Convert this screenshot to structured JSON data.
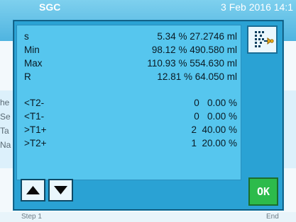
{
  "background": {
    "title_left": "SGC",
    "title_right": "3 Feb 2016 14:1",
    "side_labels": [
      "he",
      "Se",
      "Ta",
      "Na"
    ],
    "status_left": "Step 1",
    "status_right": "End"
  },
  "dialog": {
    "stats": [
      {
        "label": "s",
        "value": "5.34 % 27.2746 ml"
      },
      {
        "label": "Min",
        "value": "98.12 % 490.580 ml"
      },
      {
        "label": "Max",
        "value": "110.93 % 554.630 ml"
      },
      {
        "label": "R",
        "value": "12.81 % 64.050 ml"
      }
    ],
    "tolerances": [
      {
        "label": "<T2-",
        "value": "0   0.00 %"
      },
      {
        "label": "<T1-",
        "value": "0   0.00 %"
      },
      {
        "label": ">T1+",
        "value": "2  40.00 %"
      },
      {
        "label": ">T2+",
        "value": "1  20.00 %"
      }
    ],
    "ok_label": "OK",
    "icons": {
      "report": "print-report-icon",
      "up": "arrow-up-icon",
      "down": "arrow-down-icon"
    }
  },
  "colors": {
    "dialog_bg": "#2aa2d4",
    "panel_bg": "#56c6ee",
    "ok_green": "#2dbb4b"
  }
}
